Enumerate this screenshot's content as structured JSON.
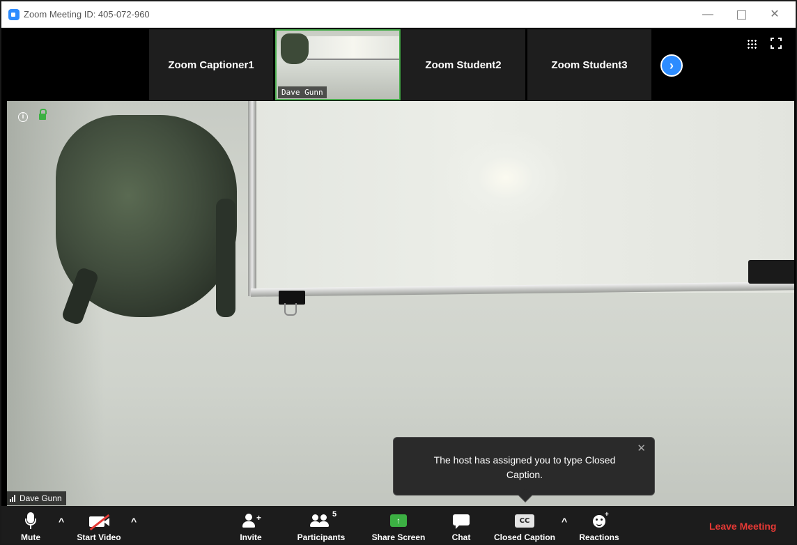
{
  "window": {
    "title": "Zoom Meeting ID: 405-072-960",
    "controls": {
      "minimize": "—",
      "close": "✕"
    }
  },
  "thumbnails": {
    "tiles": [
      {
        "label": "Zoom Captioner1"
      },
      {
        "label": "Dave Gunn",
        "video": true,
        "muted": true
      },
      {
        "label": "Zoom Student2"
      },
      {
        "label": "Zoom Student3"
      }
    ],
    "next_label": "›"
  },
  "main_video": {
    "speaker_name": "Dave Gunn",
    "info_icon": "i"
  },
  "toast": {
    "message": "The host has assigned you to type Closed Caption.",
    "close": "✕"
  },
  "toolbar": {
    "mute_label": "Mute",
    "start_video_label": "Start Video",
    "invite_label": "Invite",
    "participants_label": "Participants",
    "participants_count": "5",
    "share_screen_label": "Share Screen",
    "share_icon_glyph": "↑",
    "chat_label": "Chat",
    "closed_caption_label": "Closed Caption",
    "cc_icon_text": "CC",
    "reactions_label": "Reactions",
    "leave_label": "Leave Meeting",
    "caret": "^"
  },
  "colors": {
    "accent": "#2d8cff",
    "leave": "#e53935",
    "share_green": "#3cb043",
    "active_tile_border": "#4caf50"
  }
}
